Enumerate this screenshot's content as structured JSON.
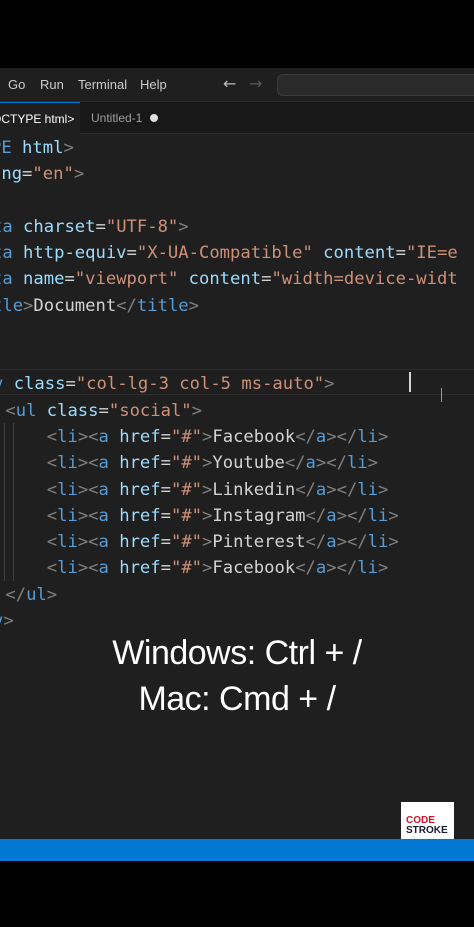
{
  "menu": {
    "items": [
      "Go",
      "Run",
      "Terminal",
      "Help"
    ],
    "back_arrow": "←",
    "forward_arrow": "→"
  },
  "tabs": [
    {
      "label": "OCTYPE html>",
      "active": true
    },
    {
      "label": "Untitled-1",
      "active": false,
      "dirty": true
    }
  ],
  "code_lines": [
    [
      [
        "tag",
        "PE "
      ],
      [
        "attr",
        "html"
      ],
      [
        "punc",
        ">"
      ]
    ],
    [
      [
        "attr",
        "ang"
      ],
      [
        "eq",
        "="
      ],
      [
        "str",
        "\"en\""
      ],
      [
        "punc",
        ">"
      ]
    ],
    [],
    [
      [
        "tag",
        "ta "
      ],
      [
        "attr",
        "charset"
      ],
      [
        "eq",
        "="
      ],
      [
        "str",
        "\"UTF-8\""
      ],
      [
        "punc",
        ">"
      ]
    ],
    [
      [
        "tag",
        "ta "
      ],
      [
        "attr",
        "http-equiv"
      ],
      [
        "eq",
        "="
      ],
      [
        "str",
        "\"X-UA-Compatible\" "
      ],
      [
        "attr",
        "content"
      ],
      [
        "eq",
        "="
      ],
      [
        "str",
        "\"IE=e"
      ]
    ],
    [
      [
        "tag",
        "ta "
      ],
      [
        "attr",
        "name"
      ],
      [
        "eq",
        "="
      ],
      [
        "str",
        "\"viewport\" "
      ],
      [
        "attr",
        "content"
      ],
      [
        "eq",
        "="
      ],
      [
        "str",
        "\"width=device-widt"
      ]
    ],
    [
      [
        "tag",
        "tle"
      ],
      [
        "punc",
        ">"
      ],
      [
        "text",
        "Document"
      ],
      [
        "punc",
        "</"
      ],
      [
        "tag",
        "title"
      ],
      [
        "punc",
        ">"
      ]
    ],
    [],
    [],
    [
      [
        "tag",
        "v "
      ],
      [
        "attr",
        "class"
      ],
      [
        "eq",
        "="
      ],
      [
        "str",
        "\"col-lg-3 col-5 ms-auto\""
      ],
      [
        "punc",
        ">"
      ]
    ],
    [
      [
        "text",
        " "
      ],
      [
        "punc",
        "<"
      ],
      [
        "tag",
        "ul "
      ],
      [
        "attr",
        "class"
      ],
      [
        "eq",
        "="
      ],
      [
        "str",
        "\"social\""
      ],
      [
        "punc",
        ">"
      ]
    ],
    [
      [
        "text",
        "     "
      ],
      [
        "punc",
        "<"
      ],
      [
        "tag",
        "li"
      ],
      [
        "punc",
        "><"
      ],
      [
        "tag",
        "a "
      ],
      [
        "attr",
        "href"
      ],
      [
        "eq",
        "="
      ],
      [
        "str",
        "\"#\""
      ],
      [
        "punc",
        ">"
      ],
      [
        "text",
        "Facebook"
      ],
      [
        "punc",
        "</"
      ],
      [
        "tag",
        "a"
      ],
      [
        "punc",
        "></"
      ],
      [
        "tag",
        "li"
      ],
      [
        "punc",
        ">"
      ]
    ],
    [
      [
        "text",
        "     "
      ],
      [
        "punc",
        "<"
      ],
      [
        "tag",
        "li"
      ],
      [
        "punc",
        "><"
      ],
      [
        "tag",
        "a "
      ],
      [
        "attr",
        "href"
      ],
      [
        "eq",
        "="
      ],
      [
        "str",
        "\"#\""
      ],
      [
        "punc",
        ">"
      ],
      [
        "text",
        "Youtube"
      ],
      [
        "punc",
        "</"
      ],
      [
        "tag",
        "a"
      ],
      [
        "punc",
        "></"
      ],
      [
        "tag",
        "li"
      ],
      [
        "punc",
        ">"
      ]
    ],
    [
      [
        "text",
        "     "
      ],
      [
        "punc",
        "<"
      ],
      [
        "tag",
        "li"
      ],
      [
        "punc",
        "><"
      ],
      [
        "tag",
        "a "
      ],
      [
        "attr",
        "href"
      ],
      [
        "eq",
        "="
      ],
      [
        "str",
        "\"#\""
      ],
      [
        "punc",
        ">"
      ],
      [
        "text",
        "Linkedin"
      ],
      [
        "punc",
        "</"
      ],
      [
        "tag",
        "a"
      ],
      [
        "punc",
        "></"
      ],
      [
        "tag",
        "li"
      ],
      [
        "punc",
        ">"
      ]
    ],
    [
      [
        "text",
        "     "
      ],
      [
        "punc",
        "<"
      ],
      [
        "tag",
        "li"
      ],
      [
        "punc",
        "><"
      ],
      [
        "tag",
        "a "
      ],
      [
        "attr",
        "href"
      ],
      [
        "eq",
        "="
      ],
      [
        "str",
        "\"#\""
      ],
      [
        "punc",
        ">"
      ],
      [
        "text",
        "Instagram"
      ],
      [
        "punc",
        "</"
      ],
      [
        "tag",
        "a"
      ],
      [
        "punc",
        "></"
      ],
      [
        "tag",
        "li"
      ],
      [
        "punc",
        ">"
      ]
    ],
    [
      [
        "text",
        "     "
      ],
      [
        "punc",
        "<"
      ],
      [
        "tag",
        "li"
      ],
      [
        "punc",
        "><"
      ],
      [
        "tag",
        "a "
      ],
      [
        "attr",
        "href"
      ],
      [
        "eq",
        "="
      ],
      [
        "str",
        "\"#\""
      ],
      [
        "punc",
        ">"
      ],
      [
        "text",
        "Pinterest"
      ],
      [
        "punc",
        "</"
      ],
      [
        "tag",
        "a"
      ],
      [
        "punc",
        "></"
      ],
      [
        "tag",
        "li"
      ],
      [
        "punc",
        ">"
      ]
    ],
    [
      [
        "text",
        "     "
      ],
      [
        "punc",
        "<"
      ],
      [
        "tag",
        "li"
      ],
      [
        "punc",
        "><"
      ],
      [
        "tag",
        "a "
      ],
      [
        "attr",
        "href"
      ],
      [
        "eq",
        "="
      ],
      [
        "str",
        "\"#\""
      ],
      [
        "punc",
        ">"
      ],
      [
        "text",
        "Facebook"
      ],
      [
        "punc",
        "</"
      ],
      [
        "tag",
        "a"
      ],
      [
        "punc",
        "></"
      ],
      [
        "tag",
        "li"
      ],
      [
        "punc",
        ">"
      ]
    ],
    [
      [
        "text",
        " "
      ],
      [
        "punc",
        "</"
      ],
      [
        "tag",
        "ul"
      ],
      [
        "punc",
        ">"
      ]
    ],
    [
      [
        "tag",
        "v"
      ],
      [
        "punc",
        ">"
      ]
    ]
  ],
  "overlay": {
    "line1": "Windows: Ctrl + /",
    "line2": "Mac: Cmd + /"
  },
  "logo": {
    "line1": "CODE",
    "line2": "STROKE"
  },
  "colors": {
    "editor_bg": "#1f1f1f",
    "status_bar": "#0078d4",
    "tag": "#569cd6",
    "attribute": "#9cdcfe",
    "string": "#ce9178",
    "text": "#d4d4d4",
    "logo_red": "#d3122d"
  }
}
